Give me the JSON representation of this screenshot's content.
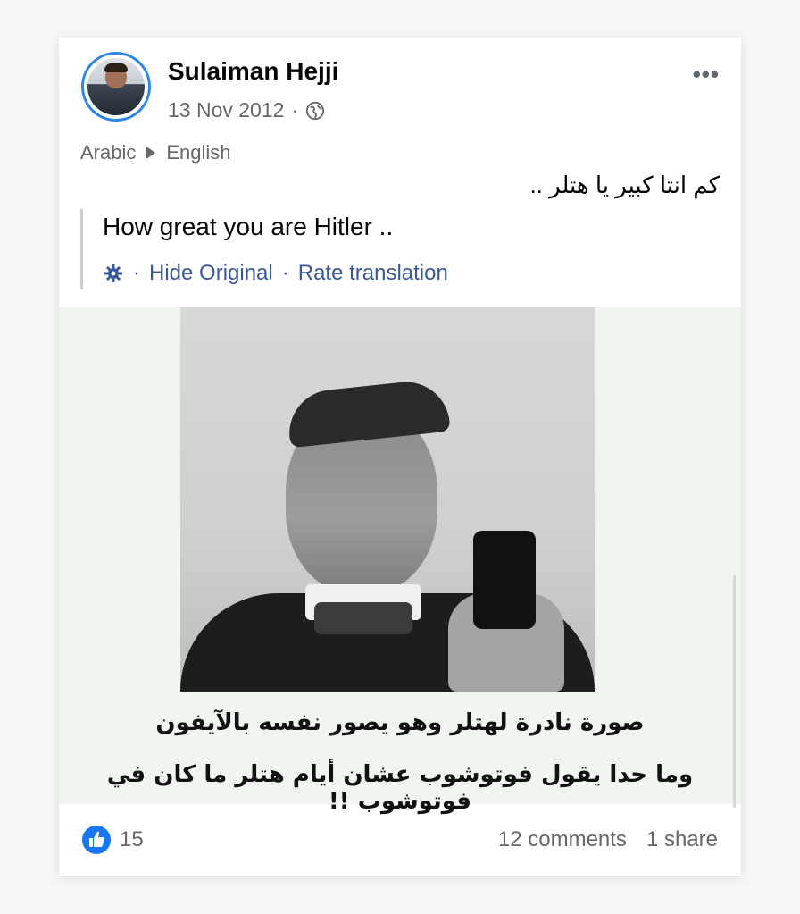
{
  "post": {
    "author": "Sulaiman Hejji",
    "date": "13 Nov 2012",
    "separator": "·",
    "more_label": "•••",
    "source_language": "Arabic",
    "target_language": "English",
    "original_text": "كم انتا كبير يا هتلر ..",
    "translated_text": "How great you are Hitler ..",
    "translation_links": {
      "hide_original": "Hide Original",
      "rate_translation": "Rate translation"
    },
    "image_caption": {
      "line1": "صورة نادرة لهتلر وهو يصور نفسه بالآيفون",
      "line2": "وما حدا يقول فوتوشوب عشان أيام هتلر ما كان في فوتوشوب !!"
    },
    "reactions_count": "15",
    "comments": "12 comments",
    "shares": "1 share"
  },
  "colors": {
    "link": "#385898",
    "like_blue": "#1877f2",
    "avatar_ring": "#2d86e8"
  },
  "icons": [
    "globe-icon",
    "gear-icon",
    "like-icon",
    "more-options-icon"
  ]
}
